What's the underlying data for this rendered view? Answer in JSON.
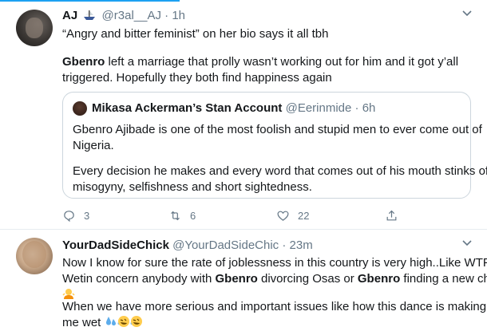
{
  "tweet1": {
    "name": "AJ",
    "handle": "@r3al__AJ",
    "separator": "·",
    "time": "1h",
    "line1": "“Angry and bitter feminist” on her bio says it all tbh",
    "para2_bold": "Gbenro",
    "para2_line1_rest": " left a marriage that prolly wasn’t working out for him and it got y’all",
    "para2_line2": "triggered. Hopefully they both find happiness again",
    "actions": {
      "reply_count": "3",
      "retweet_count": "6",
      "like_count": "22"
    }
  },
  "quoted": {
    "name": "Mikasa Ackerman’s Stan Account",
    "handle": "@Eerinmide",
    "separator": "·",
    "time": "6h",
    "line1": "Gbenro Ajibade is one of the most foolish and stupid men to ever come out of",
    "line2": "Nigeria.",
    "line3": "Every decision he makes and every word that comes out of his mouth stinks of",
    "line4": "misogyny, selfishness and short sightedness."
  },
  "tweet2": {
    "name": "YourDadSideChick",
    "handle": "@YourDadSideChic",
    "separator": "·",
    "time": "23m",
    "line1": "Now I know for sure the rate of joblessness in this country is very high..Like WTF",
    "line2_a": "Wetin concern anybody with ",
    "bold1": "Gbenro",
    "line2_b": " divorcing Osas or ",
    "bold2": "Gbenro",
    "line2_c": " finding a new chic",
    "line4": "When we have more serious and important issues like how this dance is making",
    "line5": "me wet"
  },
  "colors": {
    "accent": "#1da1f2",
    "text": "#14171a",
    "secondary": "#657786",
    "border": "#e6ecf0"
  },
  "icons": [
    "chevron-down-icon",
    "reply-icon",
    "retweet-icon",
    "like-icon",
    "share-icon",
    "verified-ship-emoji",
    "woman-shrugging-emoji",
    "sweat-droplets-emoji",
    "rofl-emoji"
  ]
}
